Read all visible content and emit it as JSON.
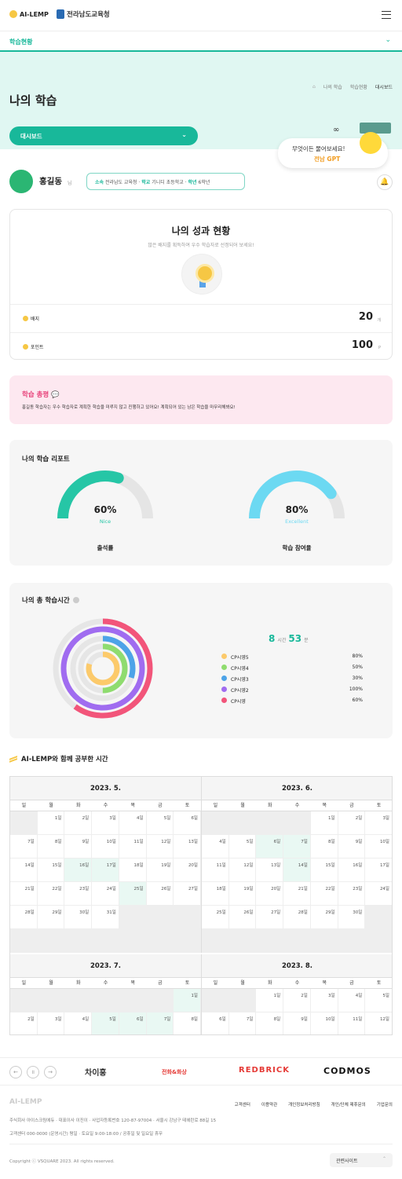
{
  "header": {
    "logo_text": "AI-LEMP",
    "org_logo_text": "전라남도교육청"
  },
  "subnav": {
    "label": "학습현황"
  },
  "hero": {
    "title": "나의 학습",
    "breadcrumb": [
      "나의 학습",
      "학습현황",
      "대시보드"
    ],
    "dashboard_select": "대시보드",
    "gpt_prompt": "무엇이든 물어보세요!",
    "gpt_name": "전남 GPT"
  },
  "user": {
    "name": "홍길동",
    "suffix": "님",
    "affiliation_label": "소속",
    "affiliation": "전라남도 교육청",
    "school_label": "학교",
    "school": "기니디 초등학교",
    "grade_label": "학년",
    "grade": "6학년"
  },
  "performance": {
    "title": "나의 성과 현황",
    "subtitle": "많은 배지를 획득하여 우수 학습자로 선정되어 보세요!",
    "badge_label": "배지",
    "badge_value": "20",
    "badge_unit": "개",
    "point_label": "포인트",
    "point_value": "100",
    "point_unit": "P"
  },
  "review": {
    "title": "학습 총평",
    "text": "홍길동 학습자는 우수 학습자로 계획한 학습을 미루지 않고 진행하고 있어요! 계획되어 있는 남은 학습을 마무리해봐요!"
  },
  "report": {
    "title": "나의 학습 리포트",
    "gauges": [
      {
        "value": 60,
        "pct": "60%",
        "grade": "Nice",
        "caption": "출석률",
        "color": "#26c6a6"
      },
      {
        "value": 80,
        "pct": "80%",
        "grade": "Excellent",
        "caption": "학습 참여율",
        "color": "#6cd9f2"
      }
    ]
  },
  "study_time": {
    "title": "나의 총 학습시간",
    "hours": "8",
    "hours_unit": "시간",
    "minutes": "53",
    "minutes_unit": "분",
    "items": [
      {
        "name": "CP시영5",
        "pct": "80%",
        "value": 80,
        "color": "#fcca6b"
      },
      {
        "name": "CP시영4",
        "pct": "50%",
        "value": 50,
        "color": "#8fdc6f"
      },
      {
        "name": "CP시영3",
        "pct": "30%",
        "value": 30,
        "color": "#4da3e8"
      },
      {
        "name": "CP시영2",
        "pct": "100%",
        "value": 100,
        "color": "#a06cf0"
      },
      {
        "name": "CP시영",
        "pct": "60%",
        "value": 60,
        "color": "#f2557a"
      }
    ]
  },
  "calendar": {
    "title": "AI-LEMP와 함께 공부한 시간",
    "weekdays": [
      "일",
      "월",
      "화",
      "수",
      "목",
      "금",
      "토"
    ],
    "months": [
      {
        "title": "2023. 5.",
        "lead": 1,
        "days": 31,
        "green": [
          16,
          17,
          25
        ]
      },
      {
        "title": "2023. 6.",
        "lead": 4,
        "days": 30,
        "green": [
          6,
          7,
          14
        ]
      },
      {
        "title": "2023. 7.",
        "lead": 6,
        "days": 8,
        "green": [
          1,
          5,
          6,
          7
        ]
      },
      {
        "title": "2023. 8.",
        "lead": 2,
        "days": 12,
        "green": []
      }
    ]
  },
  "partners": [
    "차이홍",
    "전화&화상",
    "REDBRICK",
    "CODMOS"
  ],
  "footer": {
    "logo": "AI-LEMP",
    "links": [
      "고객센터",
      "이용약관",
      "개인정보처리방침",
      "개인/단체 제휴문의",
      "기업문의"
    ],
    "company": "주식회사 아이스크림에듀 · 대표이사 이진이 · 사업자등록번호 120-87-97004 · 서울시 강남구 테헤란로 88길 15",
    "cs": "고객센터 000-0000 (운영시간) 평일 · 토요일 9:00-18:00 / 공휴일 및 일요일 휴무",
    "copyright": "Copyright ⓒ VSQUARE 2023. All rights reserved.",
    "family_site": "관련사이트"
  }
}
